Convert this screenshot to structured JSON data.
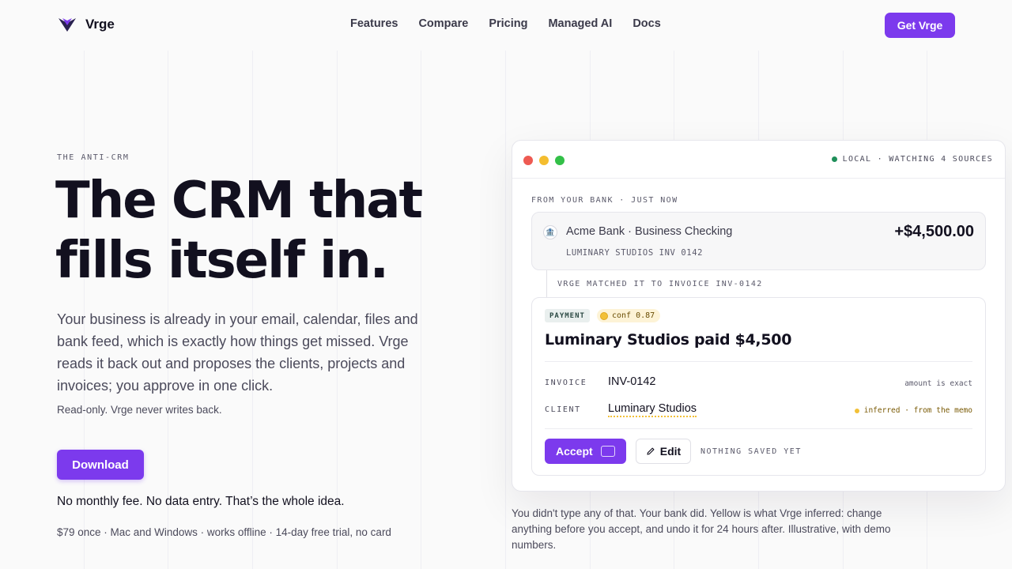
{
  "brand": {
    "name": "Vrge",
    "accent": "#7c3aed"
  },
  "nav": {
    "links": [
      "Features",
      "Compare",
      "Pricing",
      "Managed AI",
      "Docs"
    ],
    "cta": "Get Vrge"
  },
  "hero": {
    "eyebrow": "THE ANTI-CRM",
    "headline_line1": "The CRM that",
    "headline_line2": "fills itself in.",
    "lede": "Your business is already in your email, calendar, files and bank feed, which is exactly how things get missed. Vrge reads it back out and proposes the clients, projects and invoices; you approve in one click.",
    "note": "Read-only. Vrge never writes back.",
    "download": "Download",
    "tagline": "No monthly fee. No data entry. That’s the whole idea.",
    "fine_print": "$79 once · Mac and Windows · works offline · 14-day free trial, no card"
  },
  "demo": {
    "status": "LOCAL · WATCHING 4 SOURCES",
    "source_label": "FROM YOUR BANK · JUST NOW",
    "bank": {
      "icon": "bank-icon",
      "name": "Acme Bank · Business Checking",
      "amount": "+$4,500.00",
      "memo": "LUMINARY STUDIOS INV 0142"
    },
    "match_label": "VRGE MATCHED IT TO INVOICE INV-0142",
    "proposal": {
      "type_badge": "PAYMENT",
      "confidence": "conf 0.87",
      "title": "Luminary Studios paid $4,500",
      "rows": [
        {
          "label": "INVOICE",
          "value": "INV-0142",
          "note": "amount is exact"
        },
        {
          "label": "CLIENT",
          "value": "Luminary Studios",
          "note": "inferred · from the memo"
        }
      ],
      "accept": "Accept",
      "edit": "Edit",
      "saved_state": "NOTHING SAVED YET"
    }
  },
  "caption": "You didn't type any of that. Your bank did. Yellow is what Vrge inferred: change anything before you accept, and undo it for 24 hours after. Illustrative, with demo numbers."
}
